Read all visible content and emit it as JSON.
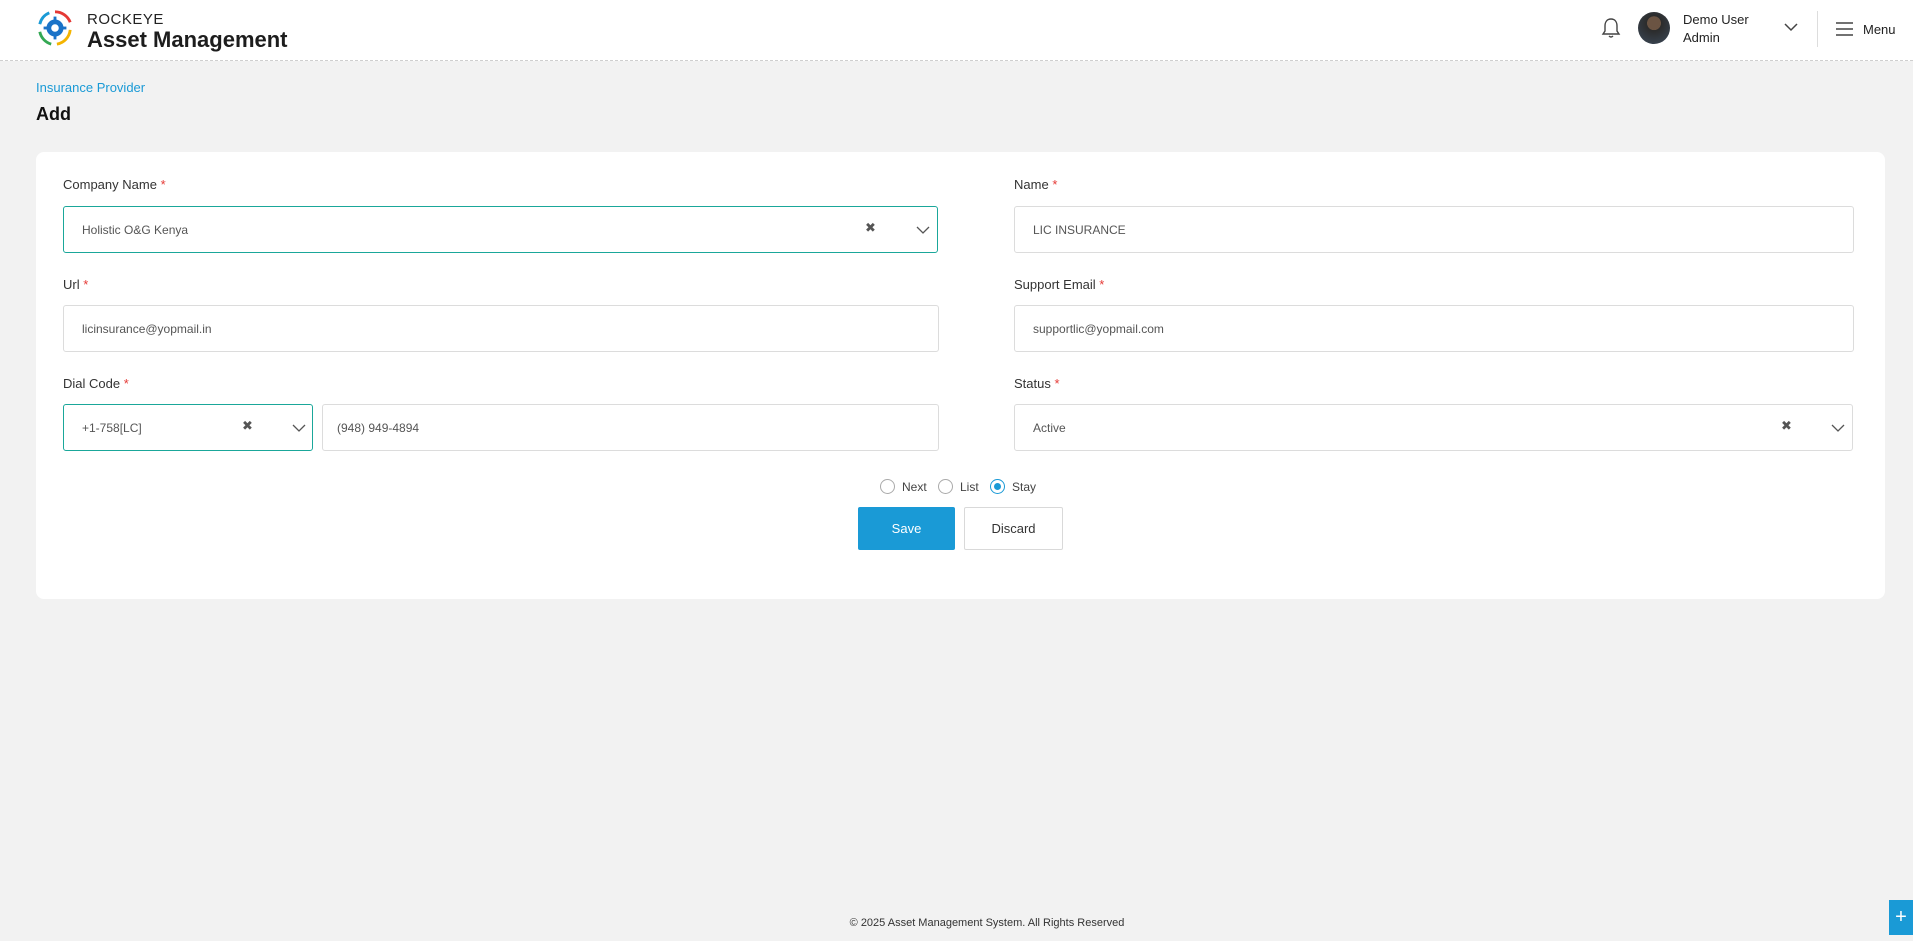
{
  "app": {
    "brand_top": "ROCKEYE",
    "brand_main": "Asset Management",
    "logo_icon": "gear-logo-icon"
  },
  "header": {
    "user_name": "Demo User",
    "user_role": "Admin",
    "menu_label": "Menu"
  },
  "breadcrumb": "Insurance Provider",
  "page_title": "Add",
  "form": {
    "company_name": {
      "label": "Company Name",
      "value": "Holistic O&G Kenya"
    },
    "name": {
      "label": "Name",
      "value": "LIC INSURANCE"
    },
    "url": {
      "label": "Url",
      "value": "licinsurance@yopmail.in"
    },
    "support_email": {
      "label": "Support Email",
      "value": "supportlic@yopmail.com"
    },
    "dial_code": {
      "label": "Dial Code",
      "value": "+1-758[LC]"
    },
    "phone": {
      "value": "(948) 949-4894"
    },
    "status": {
      "label": "Status",
      "value": "Active"
    },
    "required_mark": "*",
    "clear_glyph": "✖"
  },
  "after_save_options": [
    {
      "label": "Next",
      "selected": false
    },
    {
      "label": "List",
      "selected": false
    },
    {
      "label": "Stay",
      "selected": true
    }
  ],
  "buttons": {
    "save": "Save",
    "discard": "Discard"
  },
  "footer": "© 2025 Asset Management System. All Rights Reserved",
  "fab_label": "+",
  "colors": {
    "accent": "#1a9ad6",
    "focus_border": "#1aa79a",
    "required": "#e53935",
    "background": "#f2f2f2"
  }
}
